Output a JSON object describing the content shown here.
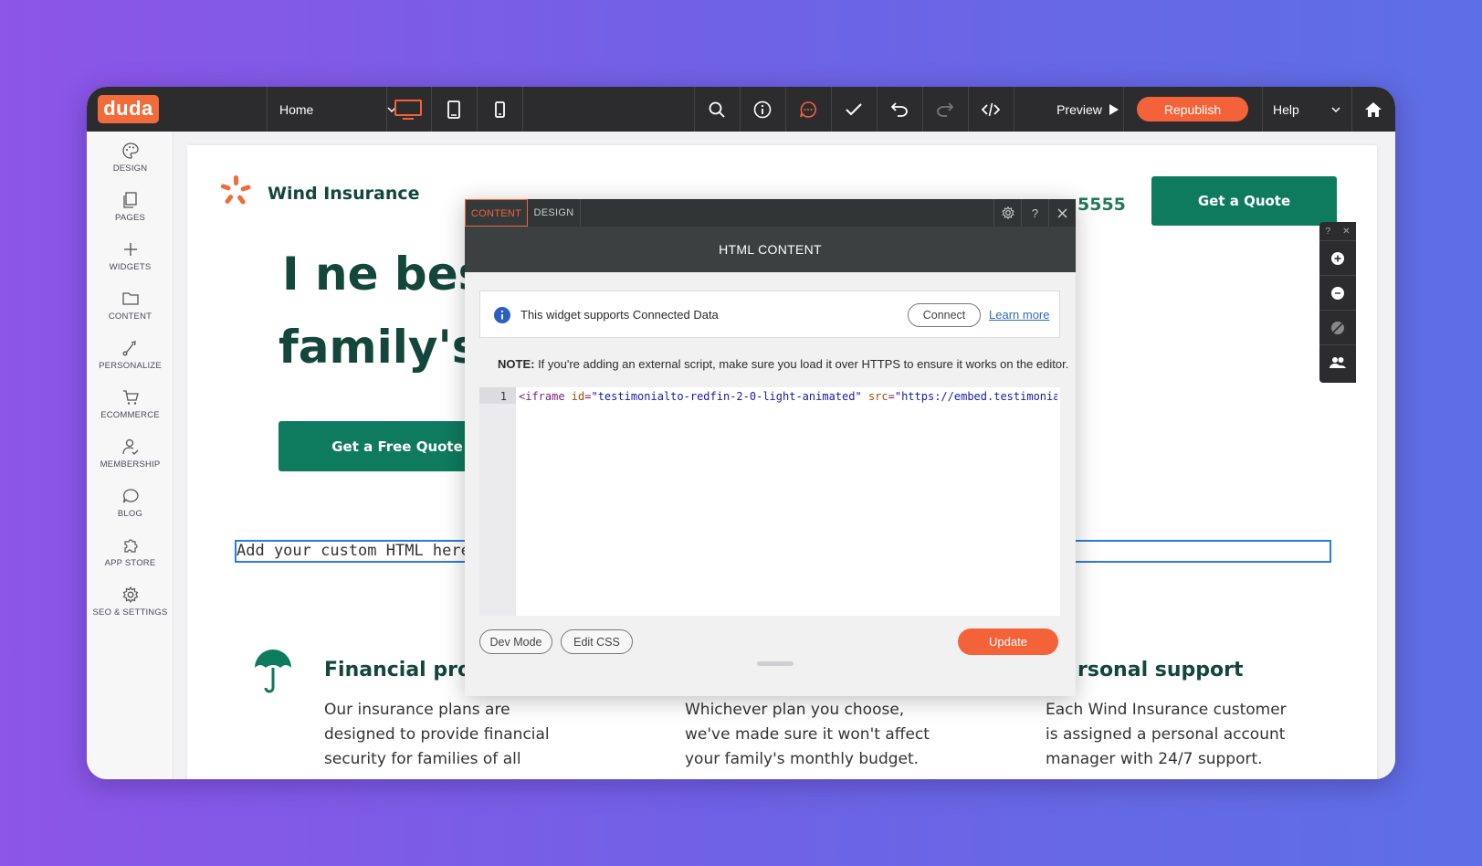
{
  "app": {
    "logo": "duda",
    "page_select": "Home",
    "preview_label": "Preview",
    "republish_label": "Republish",
    "help_label": "Help"
  },
  "sidebar": {
    "items": [
      {
        "label": "DESIGN",
        "icon": "palette-icon"
      },
      {
        "label": "PAGES",
        "icon": "pages-icon"
      },
      {
        "label": "WIDGETS",
        "icon": "plus-icon"
      },
      {
        "label": "CONTENT",
        "icon": "folder-icon"
      },
      {
        "label": "PERSONALIZE",
        "icon": "personalize-icon"
      },
      {
        "label": "ECOMMERCE",
        "icon": "cart-icon"
      },
      {
        "label": "MEMBERSHIP",
        "icon": "member-icon"
      },
      {
        "label": "BLOG",
        "icon": "chat-bubble-icon"
      },
      {
        "label": "APP STORE",
        "icon": "puzzle-icon"
      },
      {
        "label": "SEO & SETTINGS",
        "icon": "gear-icon"
      }
    ]
  },
  "site": {
    "brand": "Wind Insurance",
    "phone": "5555",
    "quote_button": "Get a Quote",
    "hero_line1": "I ne bes",
    "hero_line2": "family's",
    "free_quote_button": "Get a Free Quote",
    "custom_html_placeholder": "Add your custom HTML here",
    "features": [
      {
        "title": "Financial prot",
        "text": "Our insurance plans are designed to provide financial security for families of all"
      },
      {
        "title": "",
        "text": "Whichever plan you choose, we've made sure it won't affect your family's monthly budget."
      },
      {
        "title": "rsonal support",
        "text": "Each Wind Insurance customer is assigned a personal account manager with 24/7 support."
      }
    ]
  },
  "modal": {
    "tab_content": "CONTENT",
    "tab_design": "DESIGN",
    "title": "HTML CONTENT",
    "connected_text": "This widget supports Connected Data",
    "connect_button": "Connect",
    "learn_more": "Learn more",
    "note_label": "NOTE:",
    "note_text": " If you're adding an external script, make sure you load it over HTTPS to ensure it works on the editor.",
    "code_line_no": "1",
    "code_tag": "<iframe ",
    "code_attr_id": "id",
    "code_val_id": "\"testimonialto-redfin-2-0-light-animated\"",
    "code_attr_src": "src",
    "code_val_src": "\"https://embed.testimonial.to",
    "dev_mode_button": "Dev Mode",
    "edit_css_button": "Edit CSS",
    "update_button": "Update"
  },
  "colors": {
    "accent": "#f4623a",
    "brand_green": "#0e7a5e",
    "dark_bar": "#2c2c2e"
  }
}
